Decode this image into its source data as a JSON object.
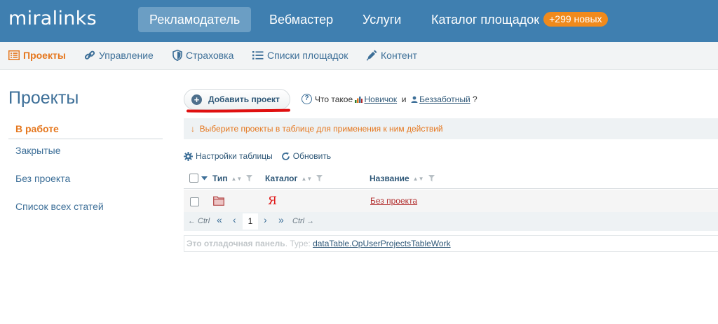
{
  "app": {
    "logo": "miralinks"
  },
  "topnav": {
    "items": [
      {
        "label": "Рекламодатель",
        "active": true
      },
      {
        "label": "Вебмастер"
      },
      {
        "label": "Услуги"
      },
      {
        "label": "Каталог площадок"
      }
    ],
    "badge": "+299 новых"
  },
  "subnav": {
    "items": [
      {
        "label": "Проекты",
        "icon": "list-icon",
        "active": true
      },
      {
        "label": "Управление",
        "icon": "link-icon"
      },
      {
        "label": "Страховка",
        "icon": "shield-icon"
      },
      {
        "label": "Списки площадок",
        "icon": "bullet-list-icon"
      },
      {
        "label": "Контент",
        "icon": "pen-icon"
      }
    ]
  },
  "sidebar": {
    "title": "Проекты",
    "items": [
      {
        "label": "В работе",
        "active": true
      },
      {
        "label": "Закрытые"
      },
      {
        "label": "Без проекта"
      },
      {
        "label": "Список всех статей"
      }
    ]
  },
  "main": {
    "add_button": "Добавить проект",
    "whatis": {
      "prefix": "Что такое",
      "link1": "Новичок",
      "conj": "и",
      "link2": "Беззаботный",
      "suffix": "?"
    },
    "hint": "Выберите проекты в таблице для применения к ним действий",
    "hint_arrow": "↓",
    "tools": {
      "settings": "Настройки таблицы",
      "refresh": "Обновить"
    },
    "table": {
      "columns": [
        "Тип",
        "Каталог",
        "Название"
      ],
      "rows": [
        {
          "type_icon": "folder-icon",
          "catalog": "Я",
          "name": "Без проекта"
        }
      ]
    },
    "pager": {
      "prev_hint": "← Ctrl",
      "first": "«",
      "prev": "‹",
      "current": "1",
      "next": "›",
      "last": "»",
      "next_hint": "Ctrl →"
    },
    "debug": {
      "label": "Это отладочная панель",
      "type_label": ". Type:",
      "type_value": "dataTable.OpUserProjectsTableWork"
    }
  },
  "colors": {
    "topbar": "#3f7fb0",
    "accent_orange": "#e5771e",
    "link_blue": "#3d6f98",
    "badge": "#f08a1c",
    "underline_red": "#e01010"
  }
}
